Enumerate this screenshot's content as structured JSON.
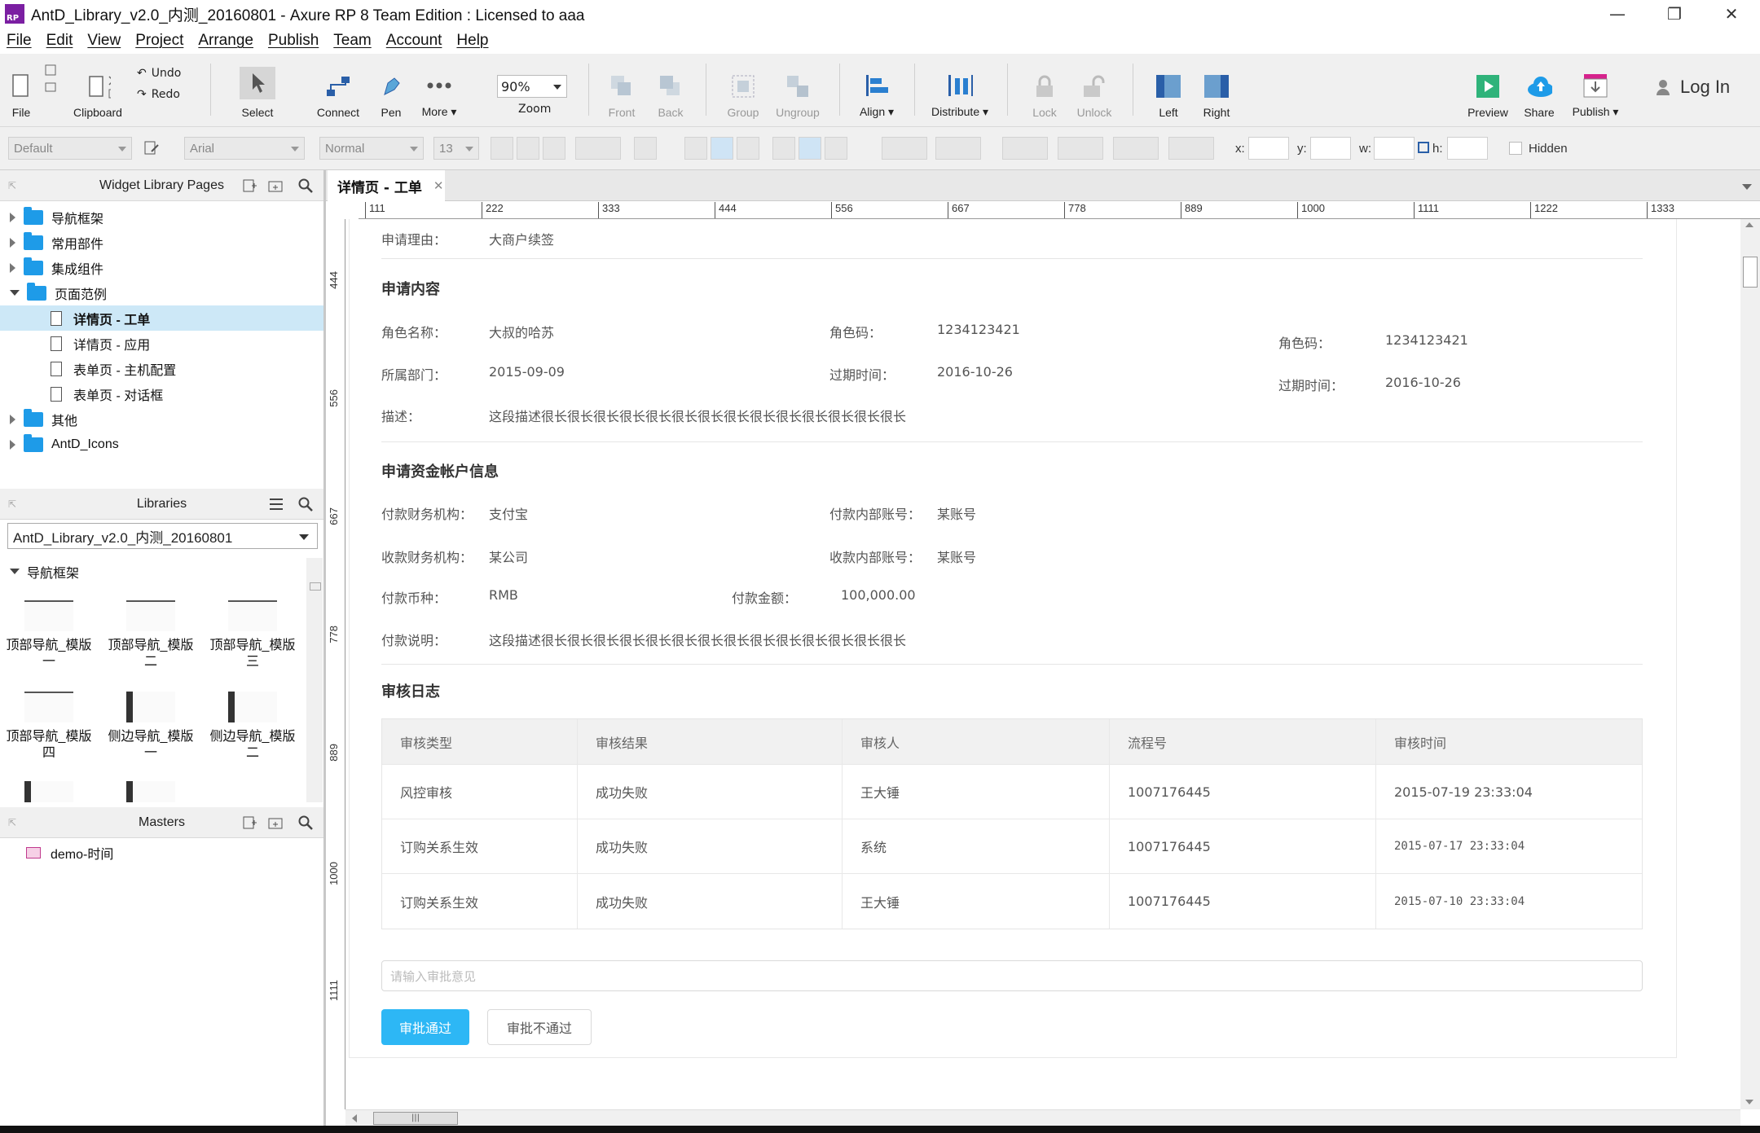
{
  "window": {
    "title": "AntD_Library_v2.0_内测_20160801 - Axure RP 8 Team Edition : Licensed to aaa",
    "logo_text": "RP",
    "minimize": "—",
    "restore": "❐",
    "close": "✕"
  },
  "menu": [
    "File",
    "Edit",
    "View",
    "Project",
    "Arrange",
    "Publish",
    "Team",
    "Account",
    "Help"
  ],
  "toolbar": {
    "file": "File",
    "clipboard": "Clipboard",
    "undo": "Undo",
    "redo": "Redo",
    "select": "Select",
    "connect": "Connect",
    "pen": "Pen",
    "more": "More ▾",
    "zoom_value": "90%",
    "zoom": "Zoom",
    "front": "Front",
    "back": "Back",
    "group": "Group",
    "ungroup": "Ungroup",
    "align": "Align ▾",
    "distribute": "Distribute ▾",
    "lock": "Lock",
    "unlock": "Unlock",
    "left": "Left",
    "right": "Right",
    "preview": "Preview",
    "share": "Share",
    "publish": "Publish ▾",
    "login": "Log In"
  },
  "formatbar": {
    "style": "Default",
    "font": "Arial",
    "weight": "Normal",
    "size": "13",
    "x_label": "x:",
    "y_label": "y:",
    "w_label": "w:",
    "h_label": "h:",
    "hidden_label": "Hidden"
  },
  "pages_panel": {
    "title": "Widget Library Pages",
    "items": [
      {
        "label": "导航框架",
        "type": "folder",
        "expanded": false
      },
      {
        "label": "常用部件",
        "type": "folder",
        "expanded": false
      },
      {
        "label": "集成组件",
        "type": "folder",
        "expanded": false
      },
      {
        "label": "页面范例",
        "type": "folder",
        "expanded": true
      },
      {
        "label": "详情页 - 工单",
        "type": "page",
        "selected": true
      },
      {
        "label": "详情页 - 应用",
        "type": "page"
      },
      {
        "label": "表单页 - 主机配置",
        "type": "page"
      },
      {
        "label": "表单页 - 对话框",
        "type": "page"
      },
      {
        "label": "其他",
        "type": "folder",
        "expanded": false
      },
      {
        "label": "AntD_Icons",
        "type": "folder",
        "expanded": false
      }
    ]
  },
  "libraries_panel": {
    "title": "Libraries",
    "selected_library": "AntD_Library_v2.0_内测_20160801",
    "group": "导航框架",
    "widgets": [
      {
        "label": "顶部导航_模版一"
      },
      {
        "label": "顶部导航_模版二"
      },
      {
        "label": "顶部导航_模版三"
      },
      {
        "label": "顶部导航_模版四"
      },
      {
        "label": "侧边导航_模版一"
      },
      {
        "label": "侧边导航_模版二"
      }
    ]
  },
  "masters_panel": {
    "title": "Masters",
    "items": [
      "demo-时间"
    ]
  },
  "document": {
    "tab_label": "详情页 - 工单",
    "ruler_h": [
      "111",
      "222",
      "333",
      "444",
      "556",
      "667",
      "778",
      "889",
      "1000",
      "1111",
      "1222",
      "1333"
    ],
    "ruler_v": [
      "444",
      "556",
      "667",
      "778",
      "889",
      "1000",
      "1111"
    ]
  },
  "page": {
    "reason_label": "申请理由：",
    "reason_value": "大商户续签",
    "section1": "申请内容",
    "role_name_label": "角色名称：",
    "role_name_value": "大叔的哈苏",
    "role_code_label": "角色码：",
    "role_code_value": "1234123421",
    "role_code2_label": "角色码：",
    "role_code2_value": "1234123421",
    "dept_label": "所属部门：",
    "dept_value": "2015-09-09",
    "expire_label": "过期时间：",
    "expire_value": "2016-10-26",
    "expire2_label": "过期时间：",
    "expire2_value": "2016-10-26",
    "desc_label": "描述：",
    "desc_value": "这段描述很长很长很长很长很长很长很长很长很长很长很长很长很长很长",
    "section2": "申请资金帐户信息",
    "pay_org_label": "付款财务机构：",
    "pay_org_value": "支付宝",
    "pay_acct_label": "付款内部账号：",
    "pay_acct_value": "某账号",
    "recv_org_label": "收款财务机构：",
    "recv_org_value": "某公司",
    "recv_acct_label": "收款内部账号：",
    "recv_acct_value": "某账号",
    "currency_label": "付款币种：",
    "currency_value": "RMB",
    "amount_label": "付款金额：",
    "amount_value": "100,000.00",
    "pay_desc_label": "付款说明：",
    "pay_desc_value": "这段描述很长很长很长很长很长很长很长很长很长很长很长很长很长很长",
    "section3": "审核日志",
    "table": {
      "headers": [
        "审核类型",
        "审核结果",
        "审核人",
        "流程号",
        "审核时间"
      ],
      "rows": [
        [
          "风控审核",
          "成功失败",
          "王大锤",
          "1007176445",
          "2015-07-19  23:33:04"
        ],
        [
          "订购关系生效",
          "成功失败",
          "系统",
          "1007176445",
          "2015-07-17  23:33:04"
        ],
        [
          "订购关系生效",
          "成功失败",
          "王大锤",
          "1007176445",
          "2015-07-10  23:33:04"
        ]
      ]
    },
    "input_placeholder": "请输入审批意见",
    "approve": "审批通过",
    "reject": "审批不通过"
  },
  "colors": {
    "accent": "#2db7f5",
    "folder": "#1e9be8",
    "selection": "#cde8f7"
  }
}
